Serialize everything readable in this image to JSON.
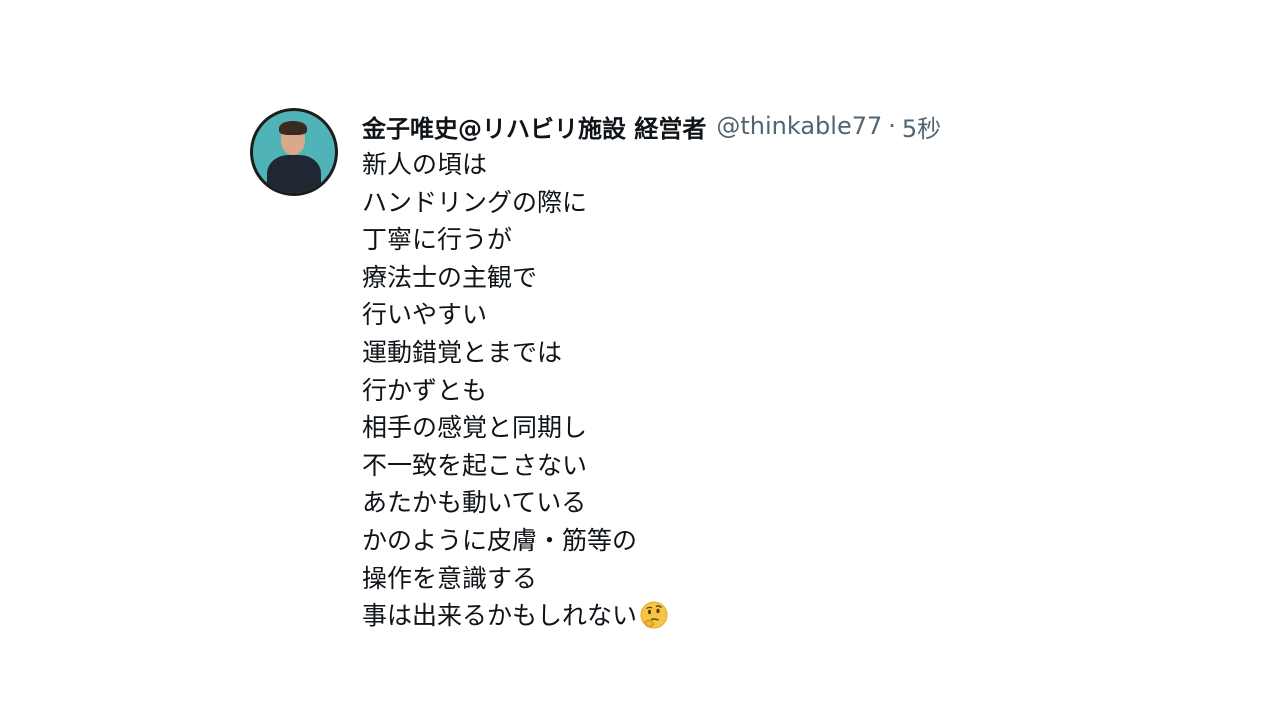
{
  "tweet": {
    "display_name": "金子唯史@リハビリ施設 経営者",
    "handle": "@thinkable77",
    "separator": "·",
    "time": "5秒",
    "avatar_icon": "user-avatar",
    "lines": [
      "新人の頃は",
      "ハンドリングの際に",
      "丁寧に行うが",
      "療法士の主観で",
      "行いやすい",
      "運動錯覚とまでは",
      "行かずとも",
      "相手の感覚と同期し",
      "不一致を起こさない",
      "あたかも動いている",
      "かのように皮膚・筋等の",
      "操作を意識する",
      "事は出来るかもしれない"
    ],
    "trailing_emoji": "thinking-face-icon"
  }
}
